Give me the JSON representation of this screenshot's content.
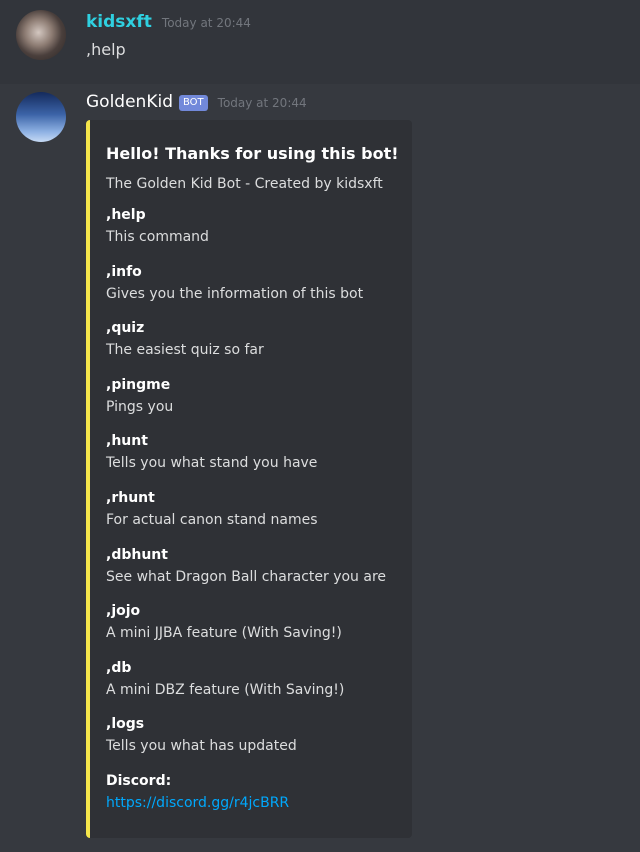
{
  "messages": [
    {
      "username": "kidsxft",
      "timestamp": "Today at 20:44",
      "text": ",help"
    },
    {
      "username": "GoldenKid",
      "bot_tag": "BOT",
      "timestamp": "Today at 20:44",
      "embed": {
        "accent_color": "#f5e64b",
        "title": "Hello! Thanks for using this bot!",
        "description": "The Golden Kid Bot - Created by kidsxft",
        "fields": [
          {
            "name": ",help",
            "value": "This command"
          },
          {
            "name": ",info",
            "value": "Gives you the information of this bot"
          },
          {
            "name": ",quiz",
            "value": "The easiest quiz so far"
          },
          {
            "name": ",pingme",
            "value": "Pings you"
          },
          {
            "name": ",hunt",
            "value": "Tells you what stand you have"
          },
          {
            "name": ",rhunt",
            "value": "For actual canon stand names"
          },
          {
            "name": ",dbhunt",
            "value": "See what Dragon Ball character you are"
          },
          {
            "name": ",jojo",
            "value": "A mini JJBA feature (With Saving!)"
          },
          {
            "name": ",db",
            "value": "A mini DBZ feature (With Saving!)"
          },
          {
            "name": ",logs",
            "value": "Tells you what has updated"
          },
          {
            "name": "Discord:",
            "value": "https://discord.gg/r4jcBRR"
          }
        ]
      }
    }
  ],
  "colors": {
    "background": "#36393f",
    "embed_background": "#2f3136",
    "username_1": "#2fd0e0",
    "bot_tag": "#7289da",
    "link": "#00a8fc"
  }
}
